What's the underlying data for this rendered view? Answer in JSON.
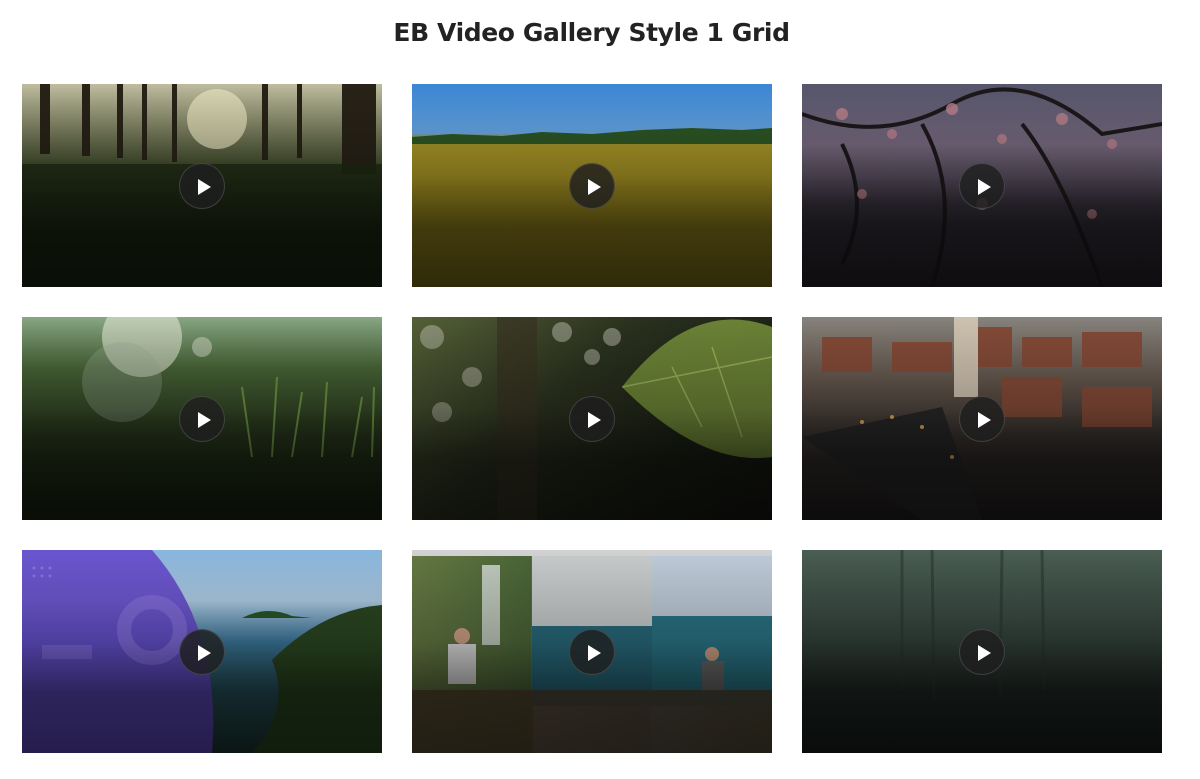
{
  "page": {
    "title": "EB Video Gallery Style 1 Grid"
  },
  "gallery": {
    "items": [
      {
        "name": "forest-sunrise",
        "icon": "play-icon"
      },
      {
        "name": "sunflower-field",
        "icon": "play-icon"
      },
      {
        "name": "cherry-blossom-branches",
        "icon": "play-icon"
      },
      {
        "name": "dewy-grass-closeup",
        "icon": "play-icon"
      },
      {
        "name": "leaf-in-forest",
        "icon": "play-icon"
      },
      {
        "name": "old-town-aerial",
        "icon": "play-icon"
      },
      {
        "name": "tropical-island",
        "icon": "play-icon"
      },
      {
        "name": "travel-collage",
        "icon": "play-icon"
      },
      {
        "name": "misty-jungle",
        "icon": "play-icon"
      }
    ]
  },
  "colors": {
    "title": "#222222",
    "play_button_bg": "#1e1e1e",
    "play_icon": "#ffffff"
  }
}
